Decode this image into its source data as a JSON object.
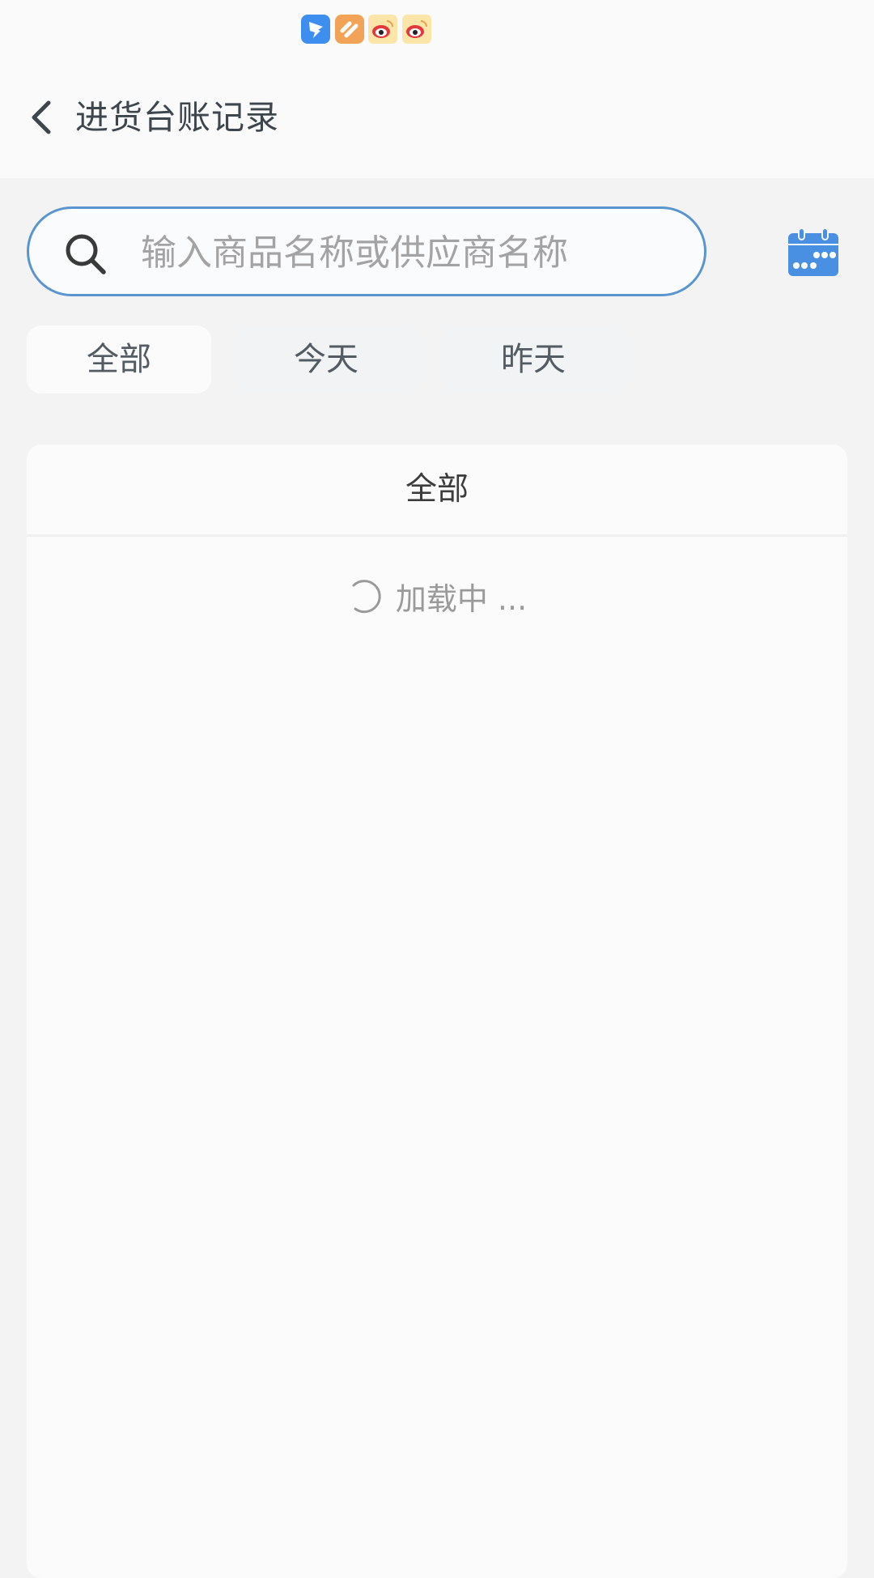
{
  "status_bar": {
    "notification_icons": [
      "dingtalk-app-icon",
      "heart-app-icon",
      "weibo-app-icon",
      "weibo-app-icon"
    ]
  },
  "header": {
    "back_icon": "chevron-left-icon",
    "title": "进货台账记录"
  },
  "search": {
    "placeholder": "输入商品名称或供应商名称",
    "value": "",
    "icon": "search-icon"
  },
  "calendar_button": {
    "icon": "calendar-icon",
    "color": "#4a90e2"
  },
  "tabs": [
    {
      "label": "全部",
      "active": true
    },
    {
      "label": "今天",
      "active": false
    },
    {
      "label": "昨天",
      "active": false
    }
  ],
  "list_card": {
    "header": "全部",
    "loading_text": "加载中 ..."
  },
  "colors": {
    "accent": "#5b95cf",
    "calendar": "#4a90e2"
  }
}
